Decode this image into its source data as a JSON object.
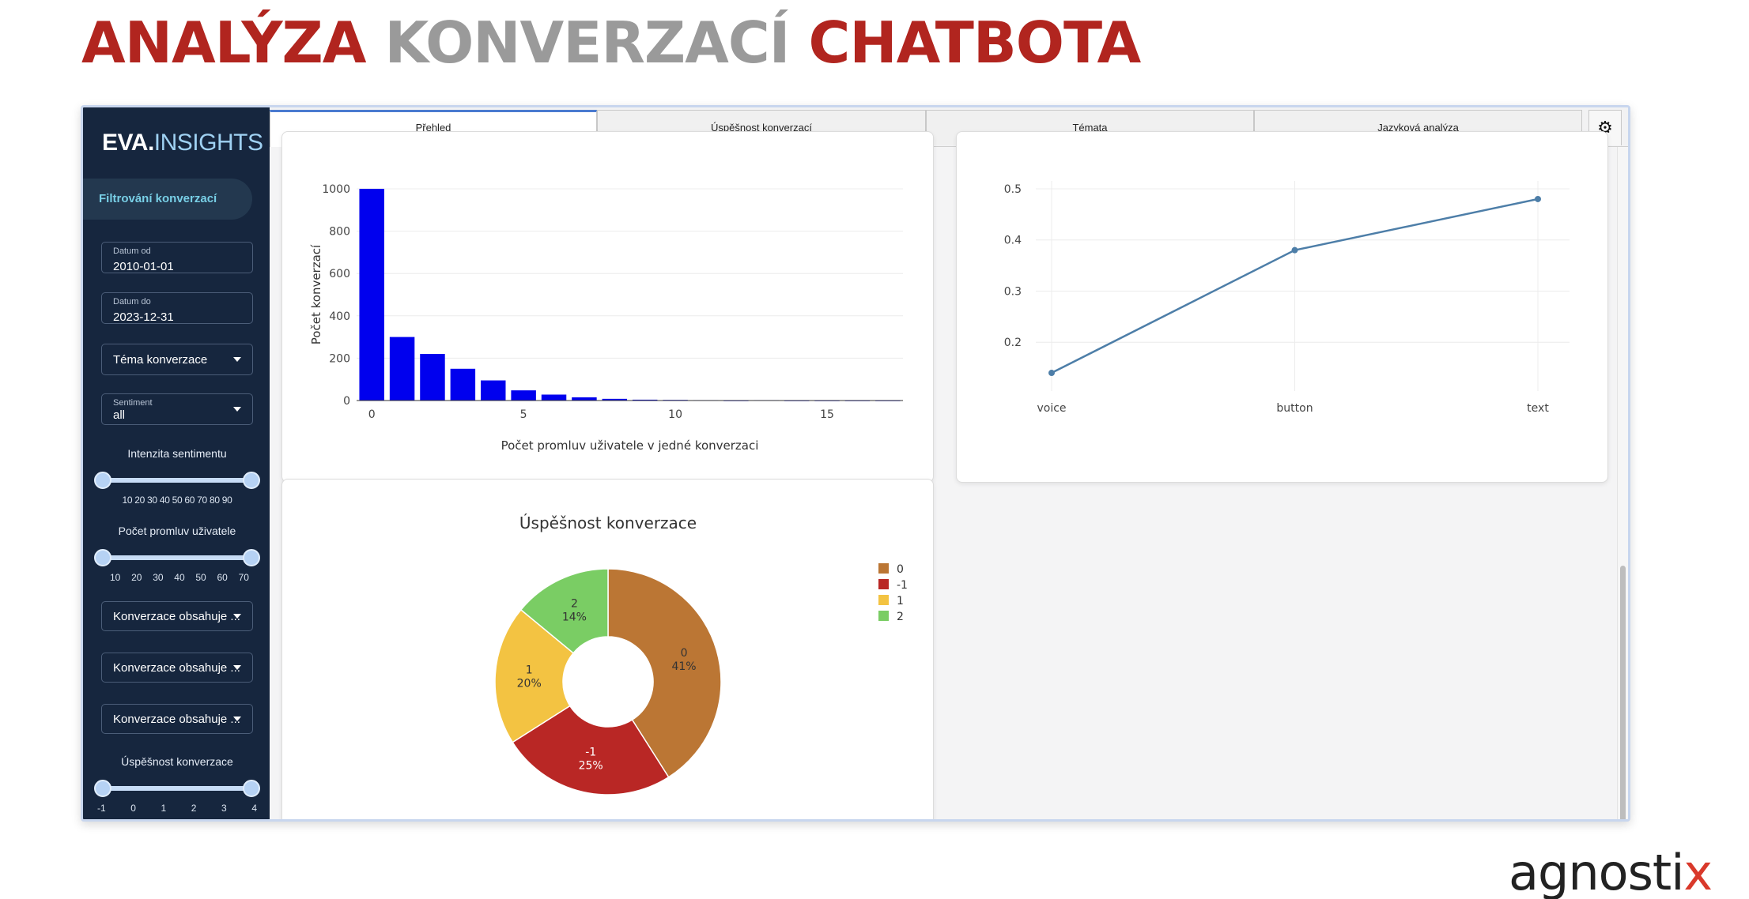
{
  "slide": {
    "title_part1": "ANALÝZA",
    "title_part2": "KONVERZACÍ",
    "title_part3": "CHATBOTA",
    "brand_main": "agnosti",
    "brand_x": "x"
  },
  "colors": {
    "red": "#b1251f",
    "gray": "#9a9a9a",
    "sidebar": "#16263e",
    "accent": "#78cfe6",
    "bar": "#0000ee",
    "line": "#4d7ea8"
  },
  "sidebar": {
    "logo_bold": "EVA.",
    "logo_light": "INSIGHTS",
    "section": "Filtrování konverzací",
    "date_from_label": "Datum od",
    "date_from_value": "2010-01-01",
    "date_to_label": "Datum do",
    "date_to_value": "2023-12-31",
    "topic_select": "Téma konverzace",
    "sentiment_label": "Sentiment",
    "sentiment_value": "all",
    "intensity_title": "Intenzita sentimentu",
    "intensity_ticks": "10 20 30 40 50 60 70 80 90",
    "utterances_title": "Počet promluv uživatele",
    "utterances_ticks": [
      "10",
      "20",
      "30",
      "40",
      "50",
      "60",
      "70"
    ],
    "contains_selects": [
      "Konverzace obsahuje ...",
      "Konverzace obsahuje ...",
      "Konverzace obsahuje ..."
    ],
    "success_title": "Úspěšnost konverzace",
    "success_ticks": [
      "-1",
      "0",
      "1",
      "2",
      "3",
      "4"
    ]
  },
  "tabs": [
    "Přehled",
    "Úspěšnost konverzací",
    "Témata",
    "Jazyková analýza"
  ],
  "settings_icon": "gear-icon",
  "chart_data": [
    {
      "type": "bar",
      "title": "",
      "xlabel": "Počet promluv uživatele v jedné konverzaci",
      "ylabel": "Počet konverzací",
      "x": [
        0,
        1,
        2,
        3,
        4,
        5,
        6,
        7,
        8,
        9,
        10,
        11,
        12,
        13,
        14,
        15,
        16,
        17
      ],
      "values": [
        1000,
        300,
        220,
        150,
        95,
        48,
        28,
        15,
        8,
        4,
        3,
        2,
        1,
        2,
        1,
        1,
        1,
        1
      ],
      "xticks": [
        0,
        5,
        10,
        15
      ],
      "yticks": [
        0,
        200,
        400,
        600,
        800,
        1000
      ],
      "xlim": [
        -0.5,
        17.5
      ],
      "ylim": [
        0,
        1000
      ],
      "grid": true,
      "color": "#0000ee"
    },
    {
      "type": "line",
      "title": "",
      "categories": [
        "voice",
        "button",
        "text"
      ],
      "values": [
        0.14,
        0.38,
        0.48
      ],
      "yticks": [
        "0.2",
        "0.3",
        "0.4",
        "0.5"
      ],
      "ylim": [
        0.12,
        0.5
      ],
      "grid": true,
      "color": "#4d7ea8"
    },
    {
      "type": "pie",
      "title": "Úspěšnost konverzace",
      "labels": [
        "0",
        "-1",
        "1",
        "2"
      ],
      "values": [
        41,
        25,
        20,
        14
      ],
      "slice_text": [
        "41%",
        "25%",
        "20%",
        "14%"
      ],
      "colors": [
        "#bb7634",
        "#b92725",
        "#f3c342",
        "#7acd64"
      ],
      "hole": true,
      "legend": "top-right"
    }
  ]
}
